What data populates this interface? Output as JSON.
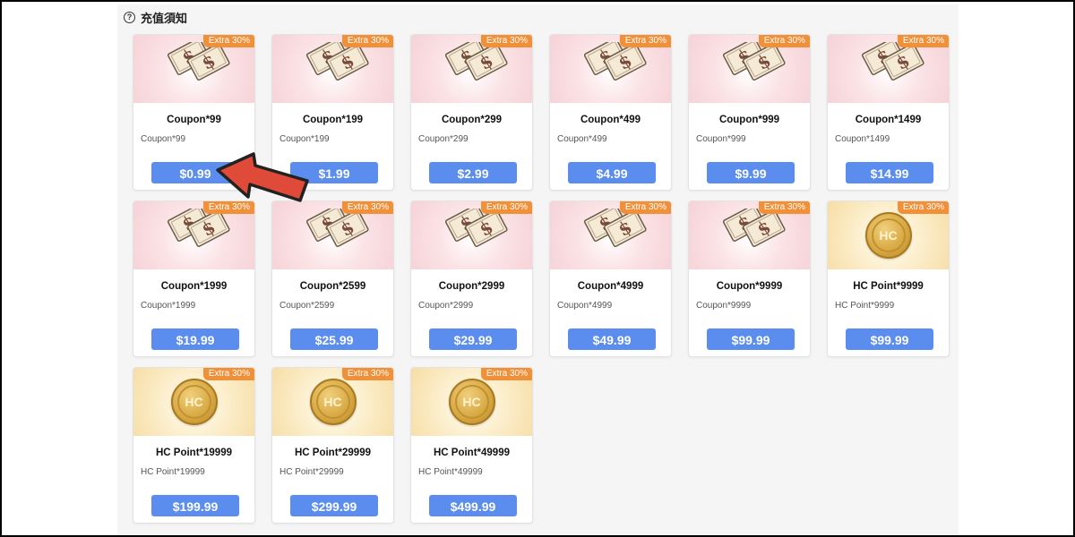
{
  "header": {
    "icon": "help-icon",
    "title": "充值須知"
  },
  "colors": {
    "button": "#5b8def",
    "badge": "#f0913a",
    "arrow": "#e04a38"
  },
  "products": [
    {
      "badge": "Extra 30%",
      "type": "coupon",
      "title": "Coupon*99",
      "subtitle": "Coupon*99",
      "price": "$0.99"
    },
    {
      "badge": "Extra 30%",
      "type": "coupon",
      "title": "Coupon*199",
      "subtitle": "Coupon*199",
      "price": "$1.99"
    },
    {
      "badge": "Extra 30%",
      "type": "coupon",
      "title": "Coupon*299",
      "subtitle": "Coupon*299",
      "price": "$2.99"
    },
    {
      "badge": "Extra 30%",
      "type": "coupon",
      "title": "Coupon*499",
      "subtitle": "Coupon*499",
      "price": "$4.99"
    },
    {
      "badge": "Extra 30%",
      "type": "coupon",
      "title": "Coupon*999",
      "subtitle": "Coupon*999",
      "price": "$9.99"
    },
    {
      "badge": "Extra 30%",
      "type": "coupon",
      "title": "Coupon*1499",
      "subtitle": "Coupon*1499",
      "price": "$14.99"
    },
    {
      "badge": "Extra 30%",
      "type": "coupon",
      "title": "Coupon*1999",
      "subtitle": "Coupon*1999",
      "price": "$19.99"
    },
    {
      "badge": "Extra 30%",
      "type": "coupon",
      "title": "Coupon*2599",
      "subtitle": "Coupon*2599",
      "price": "$25.99"
    },
    {
      "badge": "Extra 30%",
      "type": "coupon",
      "title": "Coupon*2999",
      "subtitle": "Coupon*2999",
      "price": "$29.99"
    },
    {
      "badge": "Extra 30%",
      "type": "coupon",
      "title": "Coupon*4999",
      "subtitle": "Coupon*4999",
      "price": "$49.99"
    },
    {
      "badge": "Extra 30%",
      "type": "coupon",
      "title": "Coupon*9999",
      "subtitle": "Coupon*9999",
      "price": "$99.99"
    },
    {
      "badge": "Extra 30%",
      "type": "hc",
      "coin_label": "HC",
      "title": "HC Point*9999",
      "subtitle": "HC Point*9999",
      "price": "$99.99"
    },
    {
      "badge": "Extra 30%",
      "type": "hc",
      "coin_label": "HC",
      "title": "HC Point*19999",
      "subtitle": "HC Point*19999",
      "price": "$199.99"
    },
    {
      "badge": "Extra 30%",
      "type": "hc",
      "coin_label": "HC",
      "title": "HC Point*29999",
      "subtitle": "HC Point*29999",
      "price": "$299.99"
    },
    {
      "badge": "Extra 30%",
      "type": "hc",
      "coin_label": "HC",
      "title": "HC Point*49999",
      "subtitle": "HC Point*49999",
      "price": "$499.99"
    }
  ]
}
